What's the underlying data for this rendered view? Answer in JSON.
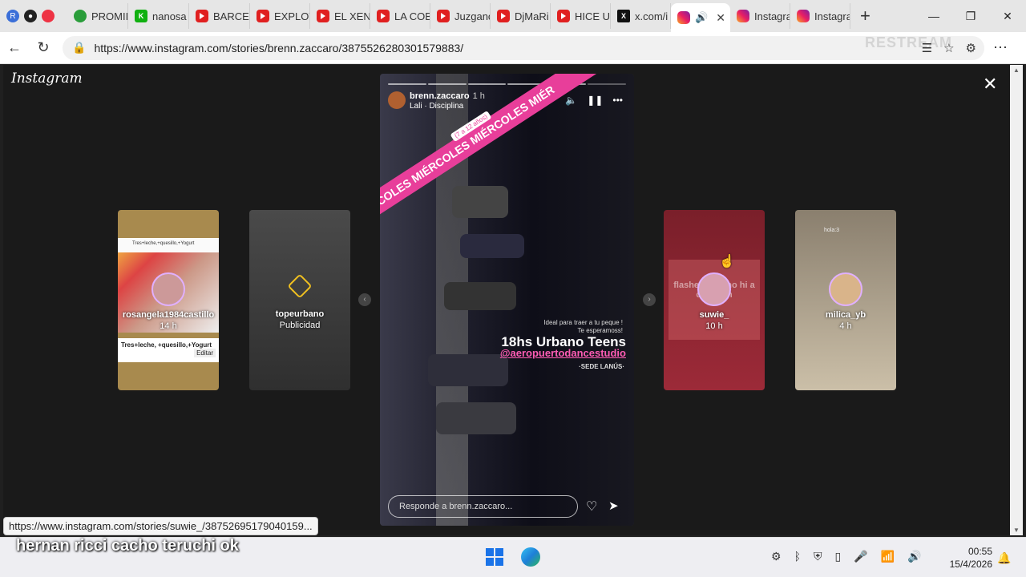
{
  "browser": {
    "tabs": [
      {
        "label": "PROMII",
        "icon": "globe-green-icon"
      },
      {
        "label": "nanosa",
        "icon": "k-icon"
      },
      {
        "label": "BARCEL",
        "icon": "youtube-icon"
      },
      {
        "label": "EXPLOT",
        "icon": "youtube-icon"
      },
      {
        "label": "EL XEN",
        "icon": "youtube-icon"
      },
      {
        "label": "LA COB",
        "icon": "youtube-icon"
      },
      {
        "label": "Juzganc",
        "icon": "youtube-icon"
      },
      {
        "label": "DjMaRi",
        "icon": "youtube-icon"
      },
      {
        "label": "HICE UN",
        "icon": "youtube-icon"
      },
      {
        "label": "x.com/i",
        "icon": "x-icon"
      },
      {
        "label": "",
        "icon": "instagram-icon",
        "active": true
      },
      {
        "label": "Instagra",
        "icon": "instagram-icon"
      },
      {
        "label": "Instagra",
        "icon": "instagram-icon"
      }
    ],
    "url": "https://www.instagram.com/stories/brenn.zaccaro/3875526280301579883/",
    "watermark": "RESTREAM",
    "status_url": "https://www.instagram.com/stories/suwie_/38752695179040159..."
  },
  "instagram": {
    "logo": "Instagram",
    "side_stories": [
      {
        "user": "rosangela1984castillo",
        "time": "14 h",
        "screen_title": "Tres+leche,+quesillo,+Yogurt",
        "caption": "Tres+leche, +quesillo,+Yogurt",
        "edit": "Editar"
      },
      {
        "user": "topeurbano",
        "time": "Publicidad"
      },
      {
        "user": "suwie_",
        "time": "10 h",
        "blur_text": "flashe spa y no hi a chan um"
      },
      {
        "user": "milica_yb",
        "time": "4 h",
        "note": "hola:3"
      }
    ],
    "main_story": {
      "user": "brenn.zaccaro",
      "time": "1 h",
      "music": "Lali · Disciplina",
      "banner": "MIÉRCOLES MIÉRCOLES MIÉRCOLES MIÉR",
      "age_tag": "(7 a 12 años)",
      "small_text_1": "Ideal para traer a tu peque !",
      "small_text_2": "Te esperamoss!",
      "headline": "18hs Urbano Teens",
      "handle": "@aeropuertodancestudio",
      "sede": "·SEDE LANÚS·",
      "reply_placeholder": "Responde a brenn.zaccaro..."
    }
  },
  "overlay_caption": "hernan ricci cacho teruchi ok",
  "taskbar": {
    "time": "00:55",
    "date": "15/4/2026"
  }
}
